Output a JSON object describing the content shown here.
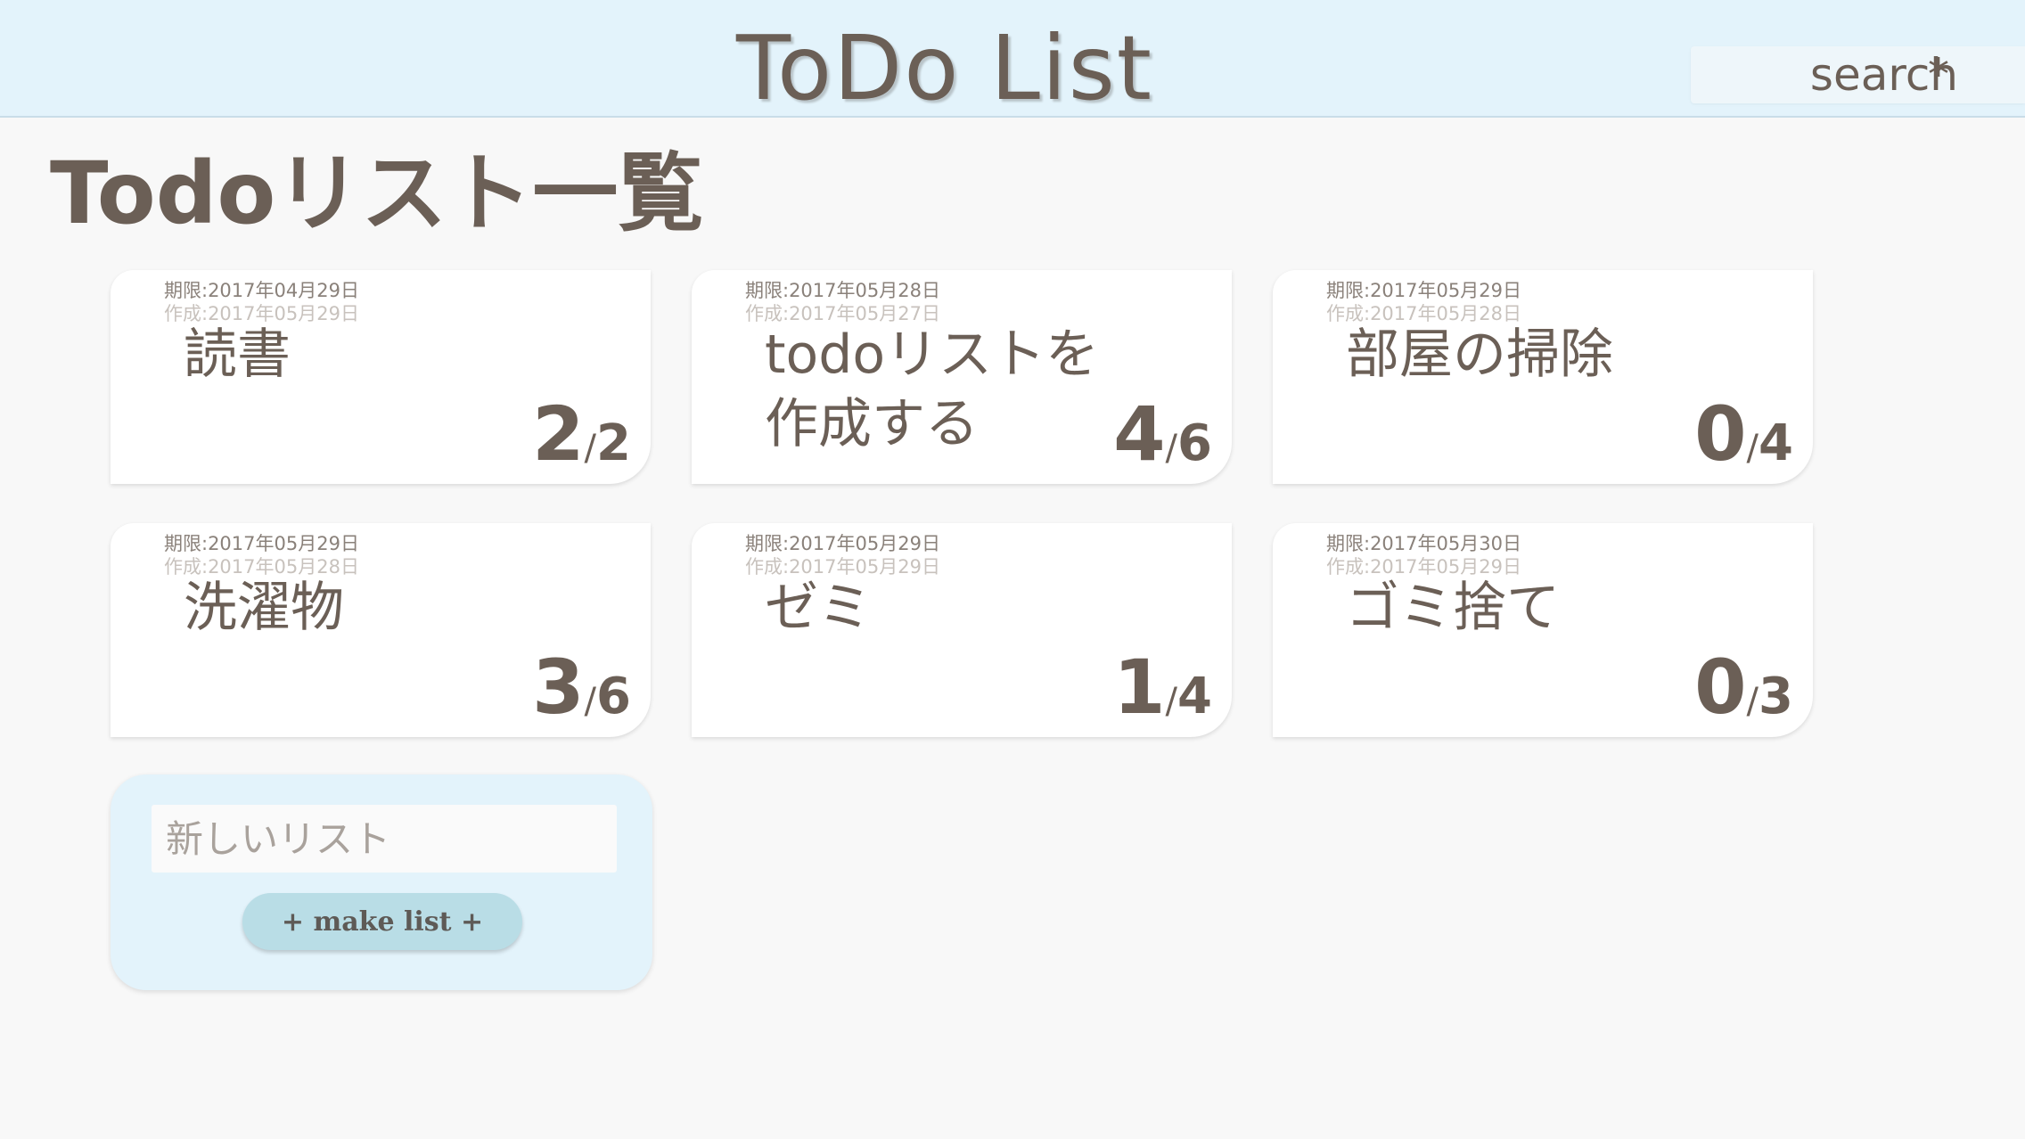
{
  "header": {
    "title": "ToDo List",
    "search_placeholder": "search",
    "search_star": "*"
  },
  "page_title": "Todoリスト一覧",
  "cards": [
    {
      "deadline": "期限:2017年04月29日",
      "created": "作成:2017年05月29日",
      "title": "読書",
      "done": "2",
      "total": "2"
    },
    {
      "deadline": "期限:2017年05月28日",
      "created": "作成:2017年05月27日",
      "title": "todoリストを作成する",
      "done": "4",
      "total": "6"
    },
    {
      "deadline": "期限:2017年05月29日",
      "created": "作成:2017年05月28日",
      "title": "部屋の掃除",
      "done": "0",
      "total": "4"
    },
    {
      "deadline": "期限:2017年05月29日",
      "created": "作成:2017年05月28日",
      "title": "洗濯物",
      "done": "3",
      "total": "6"
    },
    {
      "deadline": "期限:2017年05月29日",
      "created": "作成:2017年05月29日",
      "title": "ゼミ",
      "done": "1",
      "total": "4"
    },
    {
      "deadline": "期限:2017年05月30日",
      "created": "作成:2017年05月29日",
      "title": "ゴミ捨て",
      "done": "0",
      "total": "3"
    }
  ],
  "progress_separator": "/",
  "new_list": {
    "placeholder": "新しいリスト",
    "button_label": "+ make list +"
  },
  "colors": {
    "header_bg": "#e3f3fb",
    "text": "#6b5f56",
    "button_bg": "#b9dde6"
  }
}
